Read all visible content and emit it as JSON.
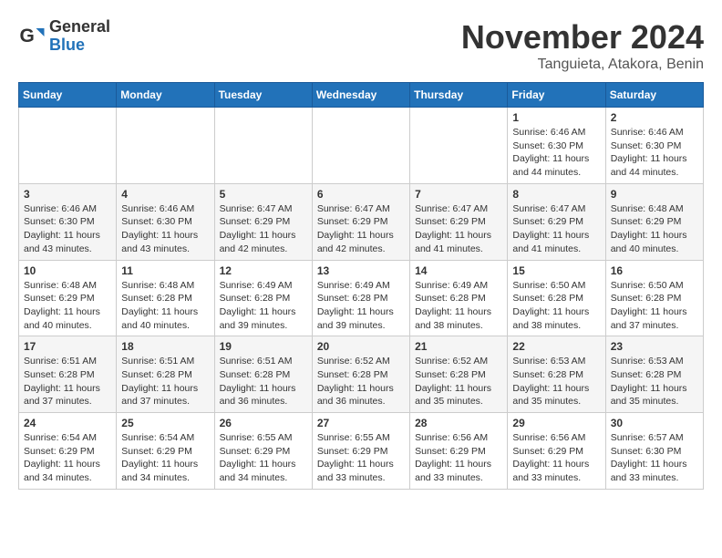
{
  "logo": {
    "general": "General",
    "blue": "Blue"
  },
  "title": {
    "month": "November 2024",
    "location": "Tanguieta, Atakora, Benin"
  },
  "weekdays": [
    "Sunday",
    "Monday",
    "Tuesday",
    "Wednesday",
    "Thursday",
    "Friday",
    "Saturday"
  ],
  "weeks": [
    [
      {
        "day": "",
        "info": ""
      },
      {
        "day": "",
        "info": ""
      },
      {
        "day": "",
        "info": ""
      },
      {
        "day": "",
        "info": ""
      },
      {
        "day": "",
        "info": ""
      },
      {
        "day": "1",
        "info": "Sunrise: 6:46 AM\nSunset: 6:30 PM\nDaylight: 11 hours\nand 44 minutes."
      },
      {
        "day": "2",
        "info": "Sunrise: 6:46 AM\nSunset: 6:30 PM\nDaylight: 11 hours\nand 44 minutes."
      }
    ],
    [
      {
        "day": "3",
        "info": "Sunrise: 6:46 AM\nSunset: 6:30 PM\nDaylight: 11 hours\nand 43 minutes."
      },
      {
        "day": "4",
        "info": "Sunrise: 6:46 AM\nSunset: 6:30 PM\nDaylight: 11 hours\nand 43 minutes."
      },
      {
        "day": "5",
        "info": "Sunrise: 6:47 AM\nSunset: 6:29 PM\nDaylight: 11 hours\nand 42 minutes."
      },
      {
        "day": "6",
        "info": "Sunrise: 6:47 AM\nSunset: 6:29 PM\nDaylight: 11 hours\nand 42 minutes."
      },
      {
        "day": "7",
        "info": "Sunrise: 6:47 AM\nSunset: 6:29 PM\nDaylight: 11 hours\nand 41 minutes."
      },
      {
        "day": "8",
        "info": "Sunrise: 6:47 AM\nSunset: 6:29 PM\nDaylight: 11 hours\nand 41 minutes."
      },
      {
        "day": "9",
        "info": "Sunrise: 6:48 AM\nSunset: 6:29 PM\nDaylight: 11 hours\nand 40 minutes."
      }
    ],
    [
      {
        "day": "10",
        "info": "Sunrise: 6:48 AM\nSunset: 6:29 PM\nDaylight: 11 hours\nand 40 minutes."
      },
      {
        "day": "11",
        "info": "Sunrise: 6:48 AM\nSunset: 6:28 PM\nDaylight: 11 hours\nand 40 minutes."
      },
      {
        "day": "12",
        "info": "Sunrise: 6:49 AM\nSunset: 6:28 PM\nDaylight: 11 hours\nand 39 minutes."
      },
      {
        "day": "13",
        "info": "Sunrise: 6:49 AM\nSunset: 6:28 PM\nDaylight: 11 hours\nand 39 minutes."
      },
      {
        "day": "14",
        "info": "Sunrise: 6:49 AM\nSunset: 6:28 PM\nDaylight: 11 hours\nand 38 minutes."
      },
      {
        "day": "15",
        "info": "Sunrise: 6:50 AM\nSunset: 6:28 PM\nDaylight: 11 hours\nand 38 minutes."
      },
      {
        "day": "16",
        "info": "Sunrise: 6:50 AM\nSunset: 6:28 PM\nDaylight: 11 hours\nand 37 minutes."
      }
    ],
    [
      {
        "day": "17",
        "info": "Sunrise: 6:51 AM\nSunset: 6:28 PM\nDaylight: 11 hours\nand 37 minutes."
      },
      {
        "day": "18",
        "info": "Sunrise: 6:51 AM\nSunset: 6:28 PM\nDaylight: 11 hours\nand 37 minutes."
      },
      {
        "day": "19",
        "info": "Sunrise: 6:51 AM\nSunset: 6:28 PM\nDaylight: 11 hours\nand 36 minutes."
      },
      {
        "day": "20",
        "info": "Sunrise: 6:52 AM\nSunset: 6:28 PM\nDaylight: 11 hours\nand 36 minutes."
      },
      {
        "day": "21",
        "info": "Sunrise: 6:52 AM\nSunset: 6:28 PM\nDaylight: 11 hours\nand 35 minutes."
      },
      {
        "day": "22",
        "info": "Sunrise: 6:53 AM\nSunset: 6:28 PM\nDaylight: 11 hours\nand 35 minutes."
      },
      {
        "day": "23",
        "info": "Sunrise: 6:53 AM\nSunset: 6:28 PM\nDaylight: 11 hours\nand 35 minutes."
      }
    ],
    [
      {
        "day": "24",
        "info": "Sunrise: 6:54 AM\nSunset: 6:29 PM\nDaylight: 11 hours\nand 34 minutes."
      },
      {
        "day": "25",
        "info": "Sunrise: 6:54 AM\nSunset: 6:29 PM\nDaylight: 11 hours\nand 34 minutes."
      },
      {
        "day": "26",
        "info": "Sunrise: 6:55 AM\nSunset: 6:29 PM\nDaylight: 11 hours\nand 34 minutes."
      },
      {
        "day": "27",
        "info": "Sunrise: 6:55 AM\nSunset: 6:29 PM\nDaylight: 11 hours\nand 33 minutes."
      },
      {
        "day": "28",
        "info": "Sunrise: 6:56 AM\nSunset: 6:29 PM\nDaylight: 11 hours\nand 33 minutes."
      },
      {
        "day": "29",
        "info": "Sunrise: 6:56 AM\nSunset: 6:29 PM\nDaylight: 11 hours\nand 33 minutes."
      },
      {
        "day": "30",
        "info": "Sunrise: 6:57 AM\nSunset: 6:30 PM\nDaylight: 11 hours\nand 33 minutes."
      }
    ]
  ]
}
